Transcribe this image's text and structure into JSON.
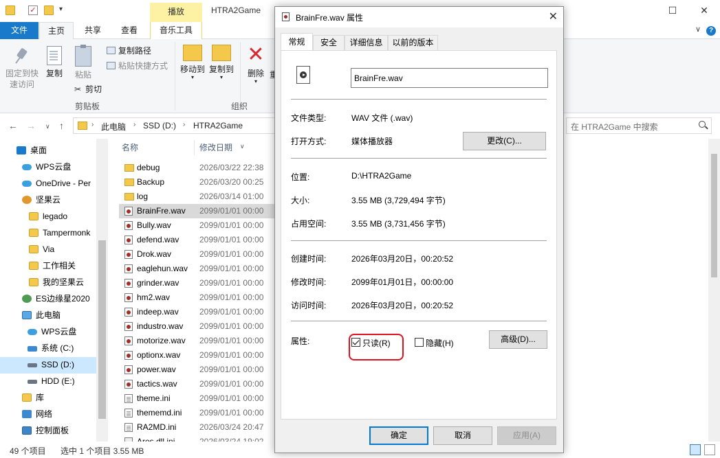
{
  "explorer": {
    "window_title": "HTRA2Game",
    "context_tab": "播放",
    "tabs": [
      "文件",
      "主页",
      "共享",
      "查看",
      "音乐工具"
    ],
    "ribbon": {
      "pin_label_1": "固定到快",
      "pin_label_2": "速访问",
      "copy": "复制",
      "paste": "粘贴",
      "copy_path": "复制路径",
      "paste_shortcut": "粘贴快捷方式",
      "cut": "剪切",
      "clipboard_group": "剪贴板",
      "move_to": "移动到",
      "copy_to": "复制到",
      "delete": "删除",
      "rename_partial": "重",
      "organize_group": "组织"
    },
    "breadcrumb": [
      "此电脑",
      "SSD (D:)",
      "HTRA2Game"
    ],
    "search_placeholder": "在 HTRA2Game 中搜索",
    "nav_items": [
      {
        "label": "桌面",
        "icon": "desktop"
      },
      {
        "label": "WPS云盘",
        "icon": "cloud"
      },
      {
        "label": "OneDrive - Per",
        "icon": "cloud"
      },
      {
        "label": "坚果云",
        "icon": "nut"
      },
      {
        "label": "legado",
        "icon": "folder"
      },
      {
        "label": "Tampermonk",
        "icon": "folder"
      },
      {
        "label": "Via",
        "icon": "folder"
      },
      {
        "label": "工作相关",
        "icon": "folder"
      },
      {
        "label": "我的坚果云",
        "icon": "folder"
      },
      {
        "label": "ES边缘星2020",
        "icon": "person"
      },
      {
        "label": "此电脑",
        "icon": "pc"
      },
      {
        "label": "WPS云盘",
        "icon": "cloud"
      },
      {
        "label": "系统 (C:)",
        "icon": "drive-c"
      },
      {
        "label": "SSD (D:)",
        "icon": "drive"
      },
      {
        "label": "HDD (E:)",
        "icon": "drive"
      },
      {
        "label": "库",
        "icon": "lib"
      },
      {
        "label": "网络",
        "icon": "net"
      },
      {
        "label": "控制面板",
        "icon": "panel"
      }
    ],
    "columns": {
      "name": "名称",
      "modified": "修改日期"
    },
    "files": [
      {
        "name": "debug",
        "date": "2026/03/22 22:38",
        "type": "folder"
      },
      {
        "name": "Backup",
        "date": "2026/03/20 00:25",
        "type": "folder"
      },
      {
        "name": "log",
        "date": "2026/03/14 01:00",
        "type": "folder"
      },
      {
        "name": "BrainFre.wav",
        "date": "2099/01/01 00:00",
        "type": "wav"
      },
      {
        "name": "Bully.wav",
        "date": "2099/01/01 00:00",
        "type": "wav"
      },
      {
        "name": "defend.wav",
        "date": "2099/01/01 00:00",
        "type": "wav"
      },
      {
        "name": "Drok.wav",
        "date": "2099/01/01 00:00",
        "type": "wav"
      },
      {
        "name": "eaglehun.wav",
        "date": "2099/01/01 00:00",
        "type": "wav"
      },
      {
        "name": "grinder.wav",
        "date": "2099/01/01 00:00",
        "type": "wav"
      },
      {
        "name": "hm2.wav",
        "date": "2099/01/01 00:00",
        "type": "wav"
      },
      {
        "name": "indeep.wav",
        "date": "2099/01/01 00:00",
        "type": "wav"
      },
      {
        "name": "industro.wav",
        "date": "2099/01/01 00:00",
        "type": "wav"
      },
      {
        "name": "motorize.wav",
        "date": "2099/01/01 00:00",
        "type": "wav"
      },
      {
        "name": "optionx.wav",
        "date": "2099/01/01 00:00",
        "type": "wav"
      },
      {
        "name": "power.wav",
        "date": "2099/01/01 00:00",
        "type": "wav"
      },
      {
        "name": "tactics.wav",
        "date": "2099/01/01 00:00",
        "type": "wav"
      },
      {
        "name": "theme.ini",
        "date": "2099/01/01 00:00",
        "type": "ini"
      },
      {
        "name": "thememd.ini",
        "date": "2099/01/01 00:00",
        "type": "ini"
      },
      {
        "name": "RA2MD.ini",
        "date": "2026/03/24 20:47",
        "type": "ini"
      },
      {
        "name": "Ares.dll.ini",
        "date": "2026/03/24 19:02",
        "type": "dll"
      }
    ],
    "status": {
      "count": "49 个项目",
      "selection": "选中 1 个项目  3.55 MB"
    }
  },
  "dialog": {
    "title": "BrainFre.wav 属性",
    "tabs": [
      "常规",
      "安全",
      "详细信息",
      "以前的版本"
    ],
    "filename": "BrainFre.wav",
    "labels": {
      "file_type": "文件类型:",
      "open_with": "打开方式:",
      "location": "位置:",
      "size": "大小:",
      "size_on_disk": "占用空间:",
      "created": "创建时间:",
      "modified": "修改时间:",
      "accessed": "访问时间:",
      "attributes": "属性:"
    },
    "values": {
      "file_type": "WAV 文件 (.wav)",
      "open_with": "媒体播放器",
      "location": "D:\\HTRA2Game",
      "size": "3.55 MB (3,729,494 字节)",
      "size_on_disk": "3.55 MB (3,731,456 字节)",
      "created": "2026年03月20日，00:20:52",
      "modified": "2099年01月01日，00:00:00",
      "accessed": "2026年03月20日，00:20:52"
    },
    "buttons": {
      "change": "更改(C)...",
      "advanced": "高级(D)...",
      "ok": "确定",
      "cancel": "取消",
      "apply": "应用(A)"
    },
    "checkboxes": {
      "readonly": "只读(R)",
      "readonly_checked": true,
      "hidden": "隐藏(H)",
      "hidden_checked": false
    }
  }
}
